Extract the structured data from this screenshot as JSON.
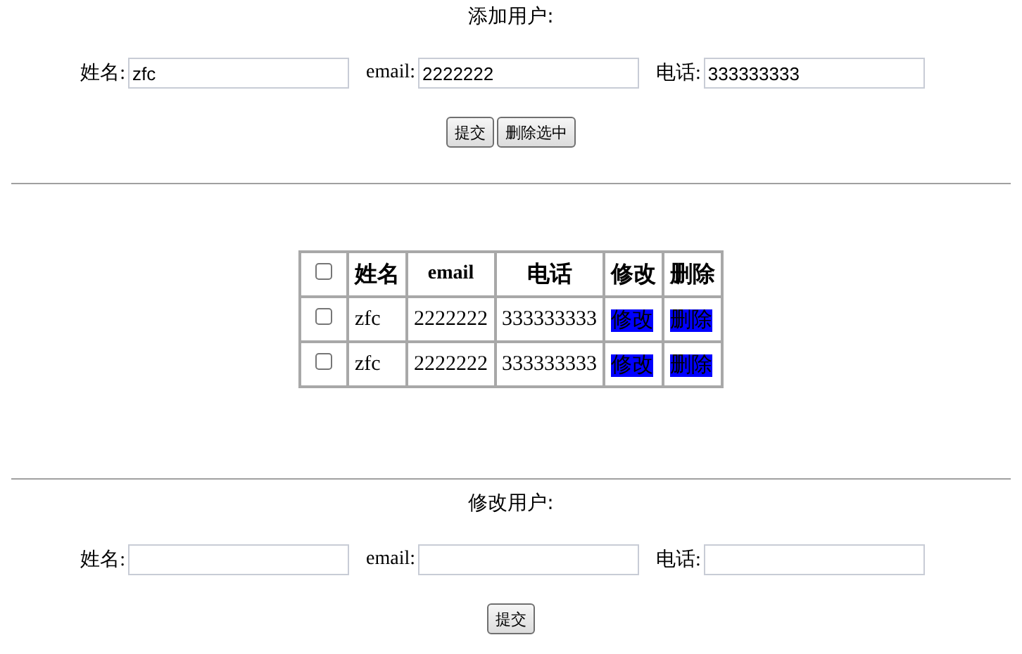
{
  "add_form": {
    "title": "添加用户:",
    "fields": [
      {
        "label": "姓名:",
        "value": "zfc"
      },
      {
        "label": "email:",
        "value": "2222222"
      },
      {
        "label": "电话:",
        "value": "333333333"
      }
    ],
    "buttons": [
      "提交",
      "删除选中"
    ]
  },
  "table": {
    "header_checked": false,
    "columns": [
      "姓名",
      "email",
      "电话",
      "修改",
      "删除"
    ],
    "rows": [
      {
        "checked": false,
        "name": "zfc",
        "email": "2222222",
        "phone": "333333333",
        "edit": "修改",
        "delete": "删除"
      },
      {
        "checked": false,
        "name": "zfc",
        "email": "2222222",
        "phone": "333333333",
        "edit": "修改",
        "delete": "删除"
      }
    ]
  },
  "edit_form": {
    "title": "修改用户:",
    "fields": [
      {
        "label": "姓名:"
      },
      {
        "label": "email:"
      },
      {
        "label": "电话:"
      }
    ],
    "buttons": [
      "提交"
    ]
  }
}
